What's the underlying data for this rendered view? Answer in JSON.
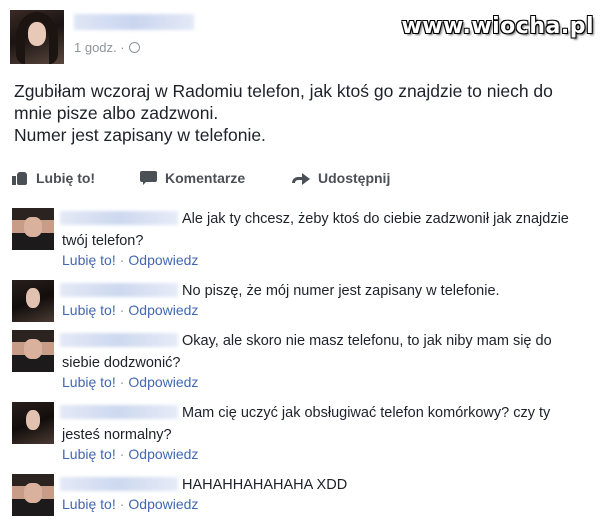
{
  "watermark": "www.wiocha.pl",
  "post": {
    "time": "1 godz. ·",
    "lines": [
      "Zgubiłam wczoraj w Radomiu telefon, jak ktoś go znajdzie to niech do",
      "mnie pisze albo zadzwoni.",
      "Numer jest zapisany w telefonie."
    ]
  },
  "actions": {
    "like": "Lubię to!",
    "comment": "Komentarze",
    "share": "Udostępnij"
  },
  "comments": [
    {
      "text": "Ale jak ty chcesz, żeby ktoś do ciebie zadzwonił jak znajdzie twój telefon?",
      "like": "Lubię to!",
      "reply": "Odpowiedz"
    },
    {
      "text": "No piszę, że mój numer jest zapisany w telefonie.",
      "like": "Lubię to!",
      "reply": "Odpowiedz"
    },
    {
      "text": "Okay, ale skoro nie masz telefonu, to jak niby mam się do siebie dodzwonić?",
      "like": "Lubię to!",
      "reply": "Odpowiedz"
    },
    {
      "text": "Mam cię uczyć jak obsługiwać telefon komórkowy? czy ty jesteś normalny?",
      "like": "Lubię to!",
      "reply": "Odpowiedz"
    },
    {
      "text": "HAHAHHAHAHAHA XDD",
      "like": "Lubię to!",
      "reply": "Odpowiedz"
    }
  ],
  "colors": {
    "link": "#4267b2",
    "meta": "#90949c",
    "text": "#1d2129"
  }
}
